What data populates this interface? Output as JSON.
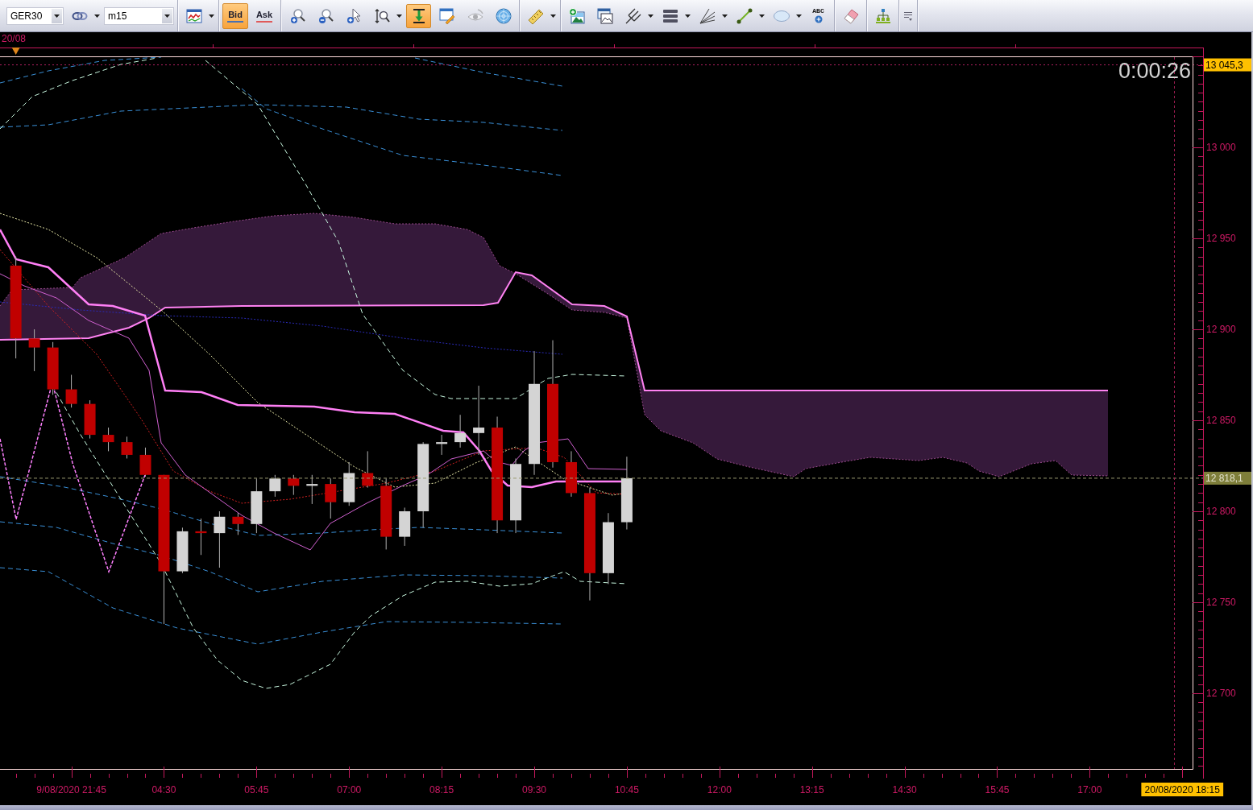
{
  "toolbar": {
    "groups": [
      {
        "items": [
          {
            "kind": "combo",
            "value": "GER30"
          },
          {
            "kind": "link",
            "active": false,
            "disabled": false,
            "dropdown": true
          },
          {
            "kind": "combo",
            "value": "m15"
          }
        ]
      },
      {
        "items": [
          {
            "kind": "indicators",
            "active": false,
            "disabled": false,
            "dropdown": true
          }
        ]
      },
      {
        "items": [
          {
            "kind": "toggle",
            "label": "Bid",
            "selected": true,
            "color": "#4a70b0"
          },
          {
            "kind": "toggle",
            "label": "Ask",
            "selected": false,
            "color": "#e05a5a"
          }
        ]
      },
      {
        "items": [
          {
            "kind": "zoomin",
            "active": false,
            "disabled": false,
            "dropdown": false
          },
          {
            "kind": "zoomout",
            "active": false,
            "disabled": false,
            "dropdown": false
          },
          {
            "kind": "zoomcursor",
            "active": false,
            "disabled": false,
            "dropdown": false
          },
          {
            "kind": "zoomvertical",
            "active": false,
            "disabled": false,
            "dropdown": true
          },
          {
            "kind": "autoscroll",
            "active": true,
            "disabled": false,
            "dropdown": false
          },
          {
            "kind": "properties",
            "active": false,
            "disabled": false,
            "dropdown": false
          },
          {
            "kind": "eye",
            "active": false,
            "disabled": true,
            "dropdown": false
          },
          {
            "kind": "globe",
            "active": false,
            "disabled": false,
            "dropdown": false
          }
        ]
      },
      {
        "items": [
          {
            "kind": "ruler",
            "active": false,
            "disabled": false,
            "dropdown": true
          }
        ]
      },
      {
        "items": [
          {
            "kind": "imageadd",
            "active": false,
            "disabled": false,
            "dropdown": false
          },
          {
            "kind": "imagewindow",
            "active": false,
            "disabled": false,
            "dropdown": false
          },
          {
            "kind": "pitchfork",
            "active": false,
            "disabled": false,
            "dropdown": true
          },
          {
            "kind": "levels",
            "active": false,
            "disabled": false,
            "dropdown": true
          },
          {
            "kind": "fan",
            "active": false,
            "disabled": false,
            "dropdown": true
          },
          {
            "kind": "line",
            "active": false,
            "disabled": false,
            "dropdown": true
          },
          {
            "kind": "ellipse",
            "active": false,
            "disabled": false,
            "dropdown": true
          },
          {
            "kind": "text",
            "label": "ABC",
            "active": false,
            "disabled": false,
            "dropdown": false
          }
        ]
      },
      {
        "items": [
          {
            "kind": "eraser",
            "active": false,
            "disabled": false,
            "dropdown": false
          }
        ]
      },
      {
        "items": [
          {
            "kind": "hierarchy",
            "active": false,
            "disabled": false,
            "dropdown": false
          }
        ]
      },
      {
        "items": [
          {
            "kind": "overflow",
            "active": false,
            "disabled": false,
            "dropdown": false
          }
        ]
      }
    ]
  },
  "chart": {
    "date_label": "20/08",
    "countdown": "0:00:26",
    "price_tags": [
      {
        "kind": "level",
        "label": "13 045,3"
      },
      {
        "kind": "last",
        "label": "12 818,1"
      }
    ],
    "price_axis": [
      "13 000",
      "12 950",
      "12 900",
      "12 850",
      "12 800",
      "12 750",
      "12 700"
    ],
    "time_axis": [
      "9/08/2020 21:45",
      "04:30",
      "05:45",
      "07:00",
      "08:15",
      "09:30",
      "10:45",
      "12:00",
      "13:15",
      "14:30",
      "15:45",
      "17:00"
    ],
    "time_tag": "20/08/2020 18:15"
  }
}
